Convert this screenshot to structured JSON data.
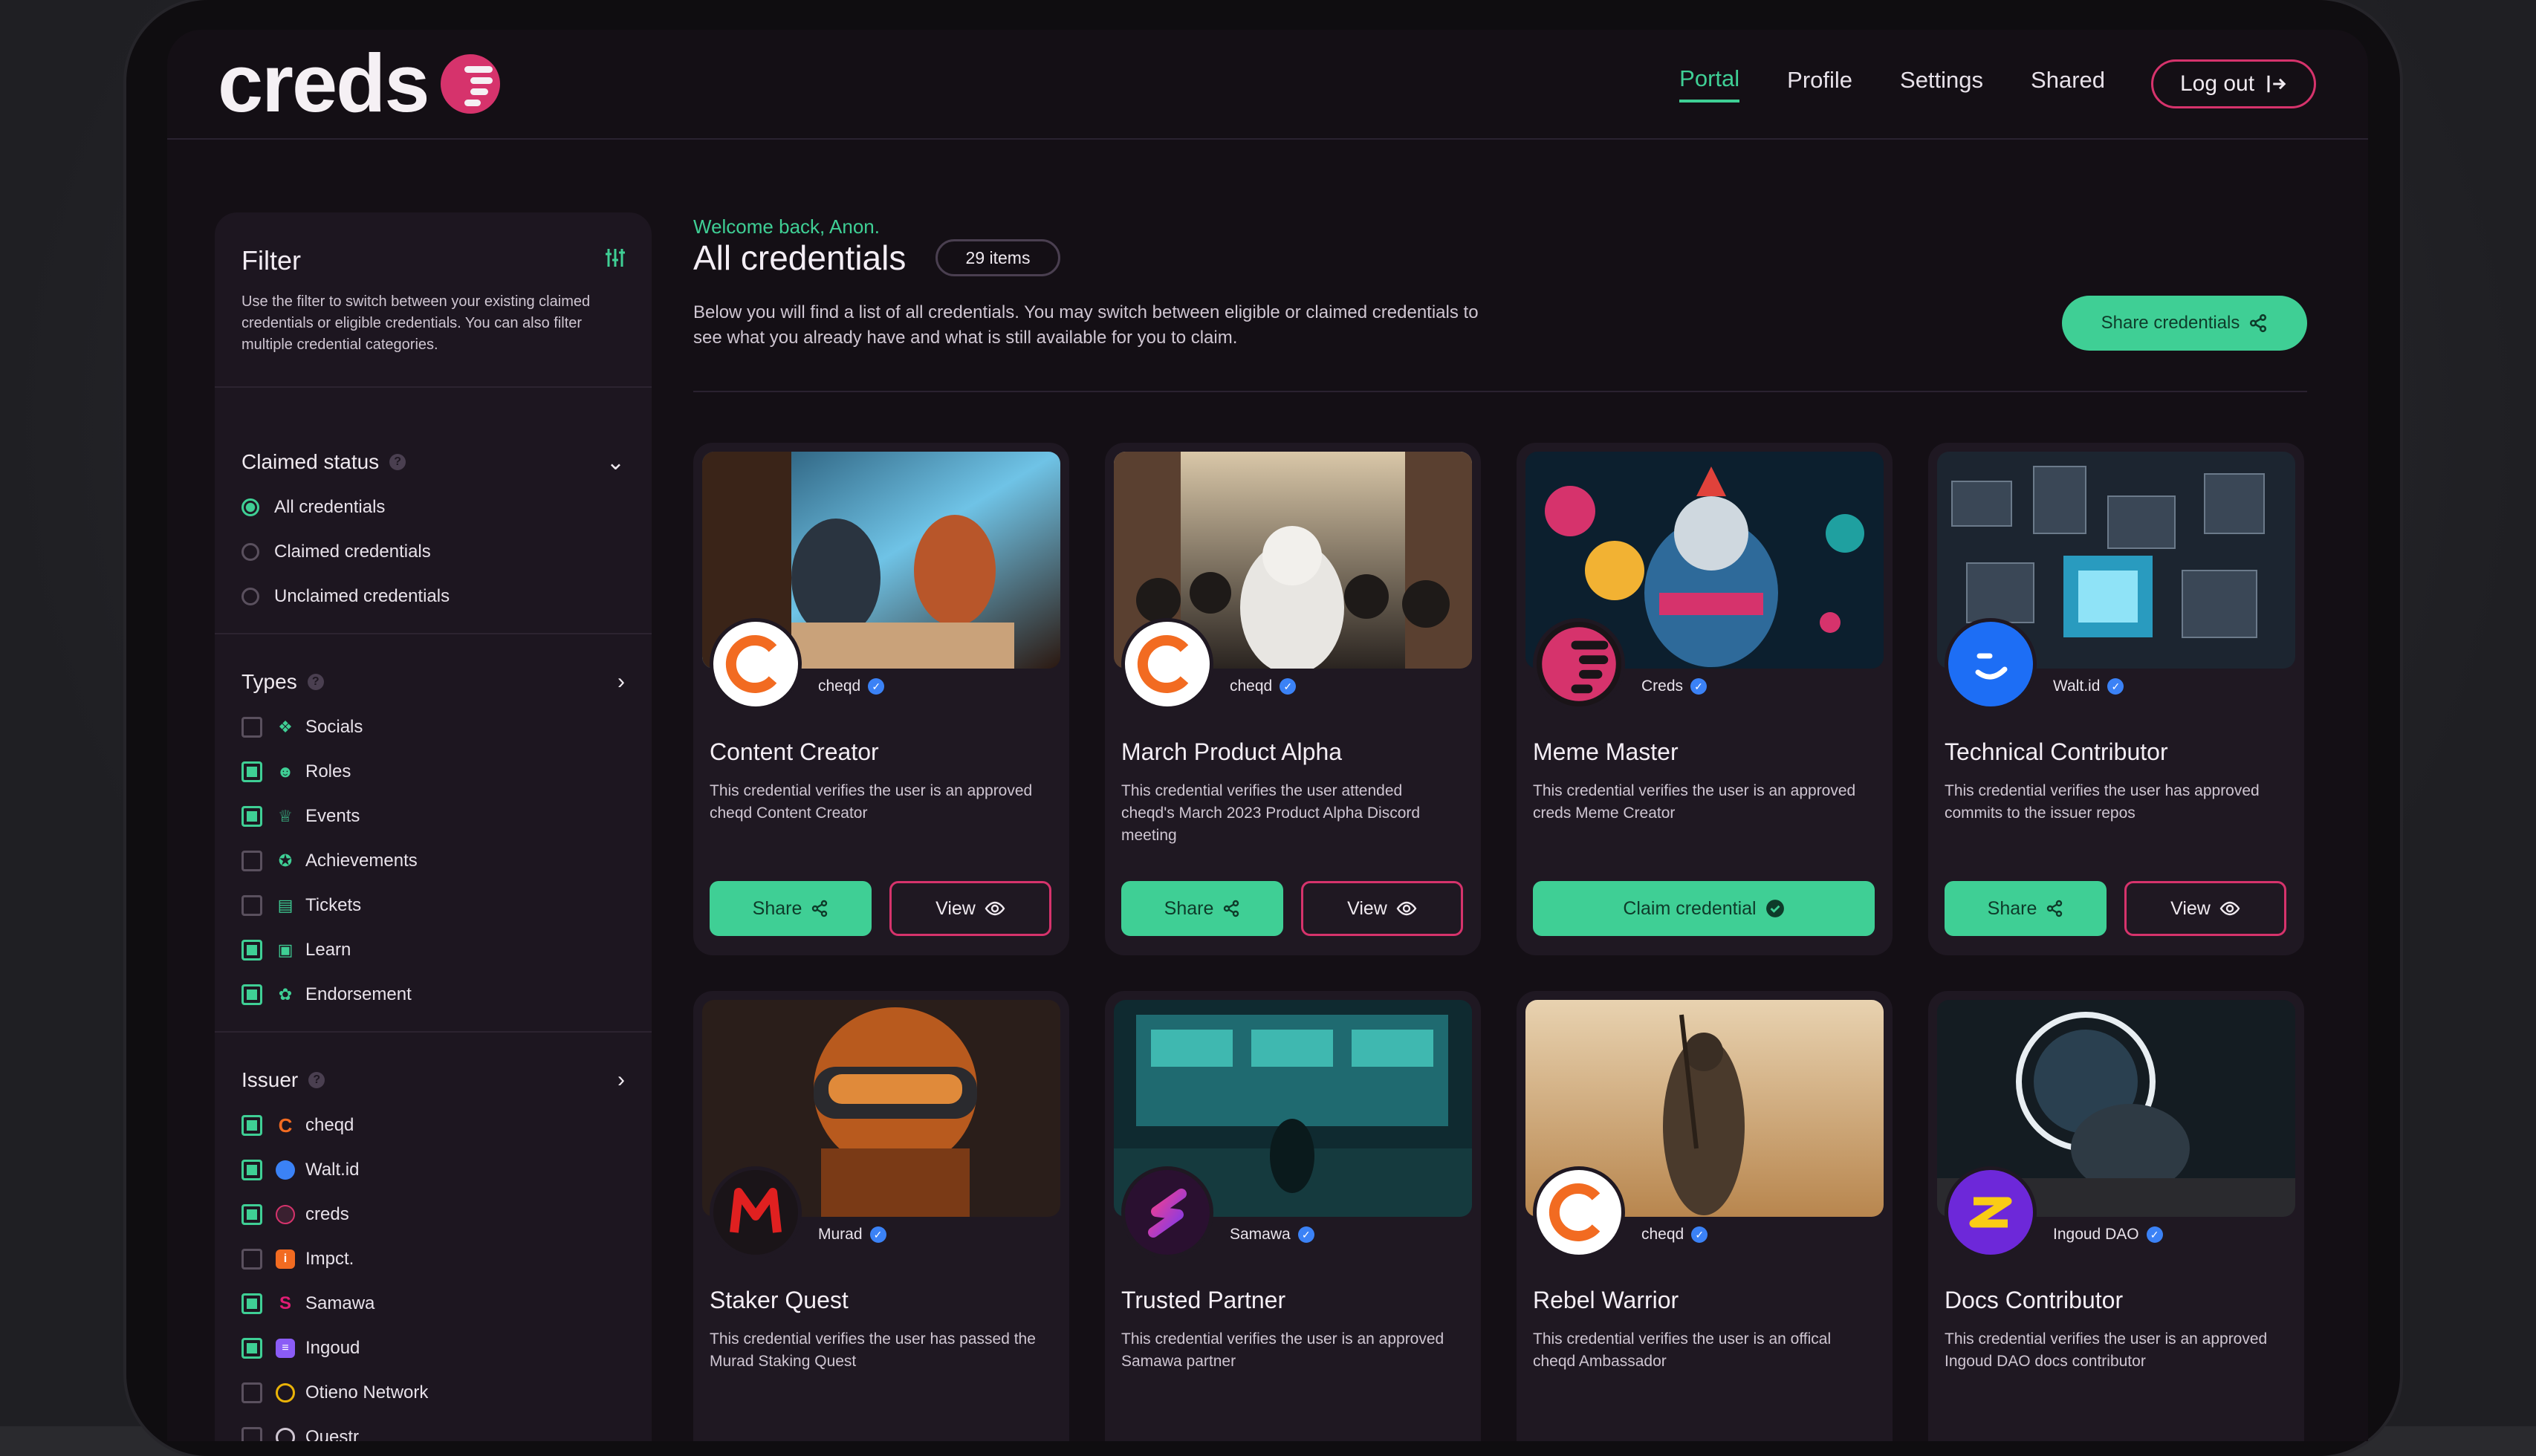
{
  "app": {
    "logo_text": "creds"
  },
  "nav": {
    "items": [
      {
        "label": "Portal",
        "active": true
      },
      {
        "label": "Profile",
        "active": false
      },
      {
        "label": "Settings",
        "active": false
      },
      {
        "label": "Shared",
        "active": false
      }
    ],
    "logout_label": "Log out"
  },
  "filter": {
    "title": "Filter",
    "description": "Use the filter to switch between your existing claimed credentials or eligible credentials. You can also filter multiple credential categories.",
    "claimed_status": {
      "title": "Claimed status",
      "options": [
        {
          "label": "All credentials",
          "selected": true
        },
        {
          "label": "Claimed credentials",
          "selected": false
        },
        {
          "label": "Unclaimed credentials",
          "selected": false
        }
      ]
    },
    "types": {
      "title": "Types",
      "options": [
        {
          "label": "Socials",
          "checked": false,
          "icon": "socials-icon"
        },
        {
          "label": "Roles",
          "checked": true,
          "icon": "roles-icon"
        },
        {
          "label": "Events",
          "checked": true,
          "icon": "events-icon"
        },
        {
          "label": "Achievements",
          "checked": false,
          "icon": "achievements-icon"
        },
        {
          "label": "Tickets",
          "checked": false,
          "icon": "tickets-icon"
        },
        {
          "label": "Learn",
          "checked": true,
          "icon": "learn-icon"
        },
        {
          "label": "Endorsement",
          "checked": true,
          "icon": "endorsement-icon"
        }
      ]
    },
    "issuer": {
      "title": "Issuer",
      "options": [
        {
          "label": "cheqd",
          "checked": true,
          "color": "#f26b21"
        },
        {
          "label": "Walt.id",
          "checked": true,
          "color": "#3b82f6"
        },
        {
          "label": "creds",
          "checked": true,
          "color": "#d6336c"
        },
        {
          "label": "Impct.",
          "checked": false,
          "color": "#f59e0b"
        },
        {
          "label": "Samawa",
          "checked": true,
          "color": "#e11d74"
        },
        {
          "label": "Ingoud",
          "checked": true,
          "color": "#8b5cf6"
        },
        {
          "label": "Otieno Network",
          "checked": false,
          "color": "#eab308"
        },
        {
          "label": "Questr",
          "checked": false,
          "color": "#cfc6d2"
        }
      ]
    }
  },
  "main": {
    "welcome": "Welcome back, Anon.",
    "title": "All credentials",
    "count_badge": "29 items",
    "description": "Below you will find a list of all credentials. You may switch between eligible or claimed credentials to see what you already have and what is still available for you to claim.",
    "share_credentials_label": "Share credentials"
  },
  "cards": [
    {
      "title": "Content Creator",
      "issuer": "cheqd",
      "description": "This credential verifies the user is an approved cheqd Content Creator",
      "claimed": true,
      "image": "creator-illustration",
      "avatar": "cheqd"
    },
    {
      "title": "March Product Alpha",
      "issuer": "cheqd",
      "description": "This credential verifies the user attended cheqd's March 2023 Product Alpha Discord meeting",
      "claimed": true,
      "image": "crowd-illustration",
      "avatar": "cheqd"
    },
    {
      "title": "Meme Master",
      "issuer": "Creds",
      "description": "This credential verifies the user is an approved creds Meme Creator",
      "claimed": false,
      "image": "astronaut-illustration",
      "avatar": "creds"
    },
    {
      "title": "Technical Contributor",
      "issuer": "Walt.id",
      "description": "This credential verifies the user has approved commits to the issuer repos",
      "claimed": true,
      "image": "city-illustration",
      "avatar": "waltid"
    },
    {
      "title": "Staker Quest",
      "issuer": "Murad",
      "description": "This credential verifies the user has passed the Murad Staking Quest",
      "claimed": true,
      "image": "robot-illustration",
      "avatar": "murad"
    },
    {
      "title": "Trusted Partner",
      "issuer": "Samawa",
      "description": "This credential verifies the user is an approved Samawa partner",
      "claimed": true,
      "image": "control-room-illustration",
      "avatar": "samawa"
    },
    {
      "title": "Rebel Warrior",
      "issuer": "cheqd",
      "description": "This credential verifies the user is an offical cheqd Ambassador",
      "claimed": true,
      "image": "desert-illustration",
      "avatar": "cheqd"
    },
    {
      "title": "Docs Contributor",
      "issuer": "Ingoud DAO",
      "description": "This credential verifies the user is an approved Ingoud DAO docs contributor",
      "claimed": false,
      "image": "portal-illustration",
      "avatar": "ingoud"
    }
  ],
  "card_labels": {
    "share": "Share",
    "view": "View",
    "claim": "Claim credential"
  },
  "colors": {
    "accent": "#3fcf95",
    "brand": "#d6336c",
    "background": "#140f15",
    "card": "#1f1822"
  }
}
